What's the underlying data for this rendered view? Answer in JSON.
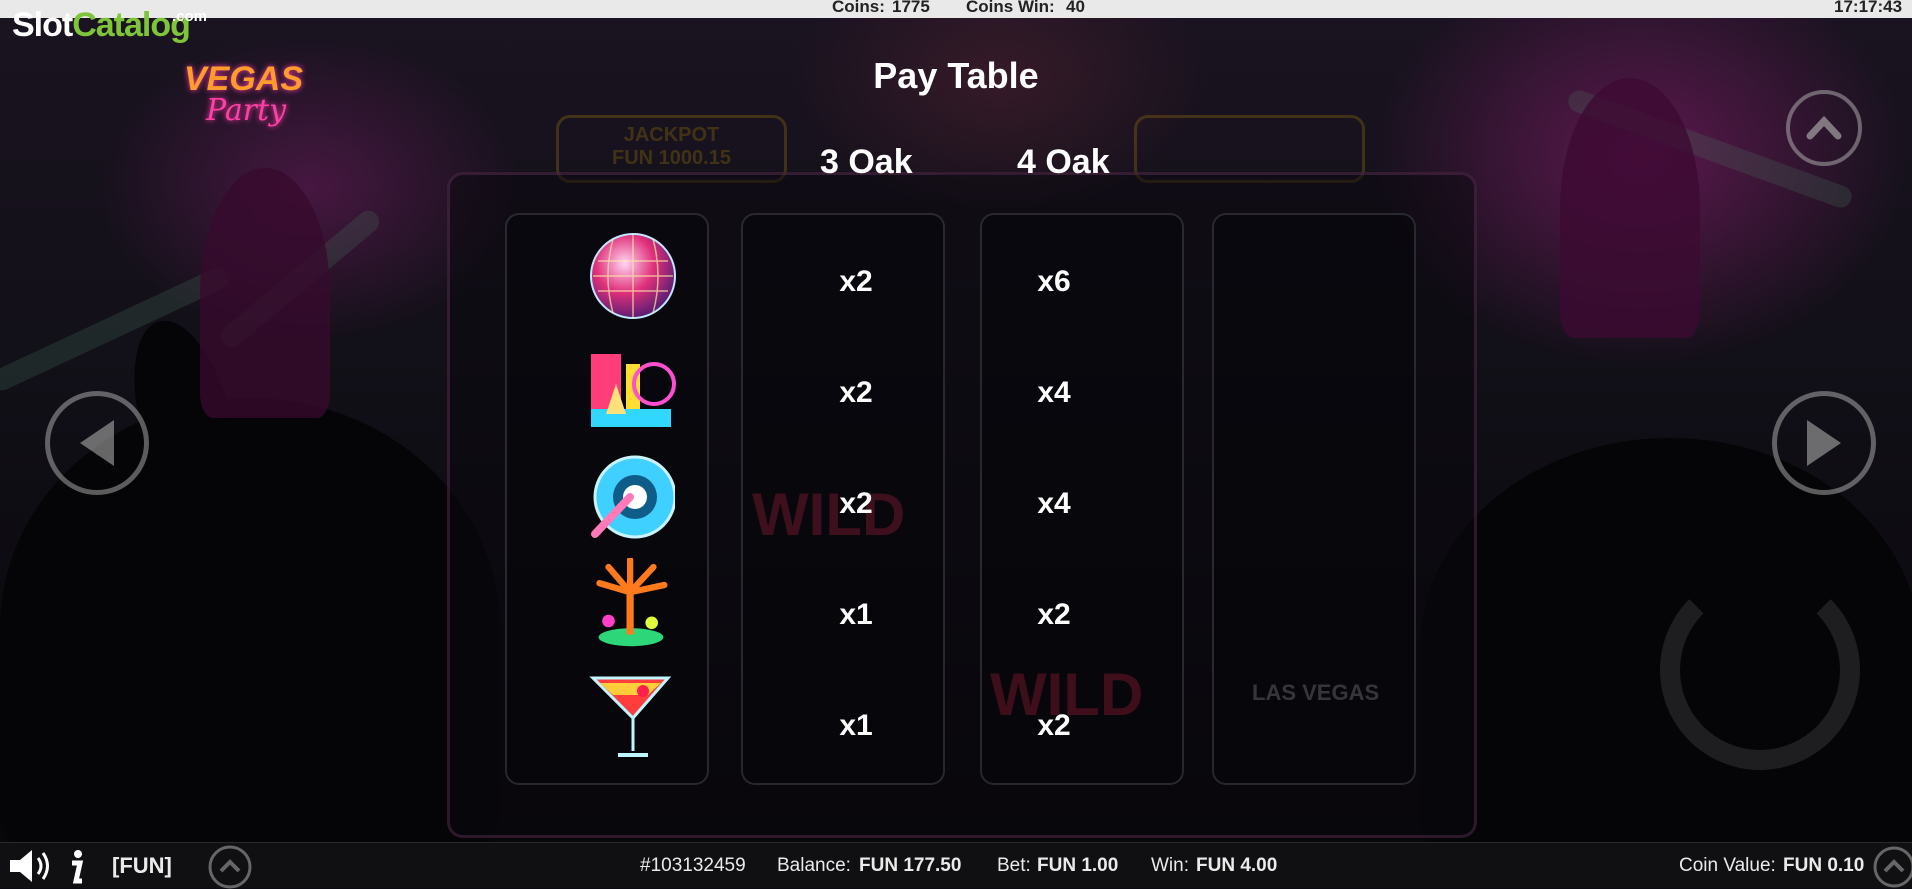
{
  "topbar": {
    "coins_label": "Coins:",
    "coins_value": "1775",
    "coins_win_label": "Coins Win:",
    "coins_win_value": "40",
    "clock": "17:17:43"
  },
  "watermark": {
    "part1": "Slot",
    "part2": "Catalog",
    "suffix": ".com"
  },
  "logo": {
    "line1": "VEGAS",
    "line2": "Party"
  },
  "paytable": {
    "title": "Pay Table",
    "col3": "3 Oak",
    "col4": "4 Oak",
    "rows": [
      {
        "symbol": "disco-ball",
        "oak3": "x2",
        "oak4": "x6"
      },
      {
        "symbol": "vegas-skyline",
        "oak3": "x2",
        "oak4": "x4"
      },
      {
        "symbol": "pool-float",
        "oak3": "x2",
        "oak4": "x4"
      },
      {
        "symbol": "palm-trees",
        "oak3": "x1",
        "oak4": "x2"
      },
      {
        "symbol": "martini-glass",
        "oak3": "x1",
        "oak4": "x2"
      }
    ]
  },
  "bg_text": {
    "jackpot": "JACKPOT",
    "jackpot_value": "FUN 1000.15",
    "wild": "WILD",
    "las_vegas": "LAS VEGAS"
  },
  "bottombar": {
    "fun": "[FUN]",
    "ticket": "#103132459",
    "balance_label": "Balance:",
    "balance_value": "FUN 177.50",
    "bet_label": "Bet:",
    "bet_value": "FUN 1.00",
    "win_label": "Win:",
    "win_value": "FUN 4.00",
    "coin_value_label": "Coin Value:",
    "coin_value_value": "FUN 0.10"
  },
  "colors": {
    "accent_green": "#7ec53a",
    "logo_pink": "#ff3fa6",
    "logo_orange": "#ff9c2a"
  }
}
